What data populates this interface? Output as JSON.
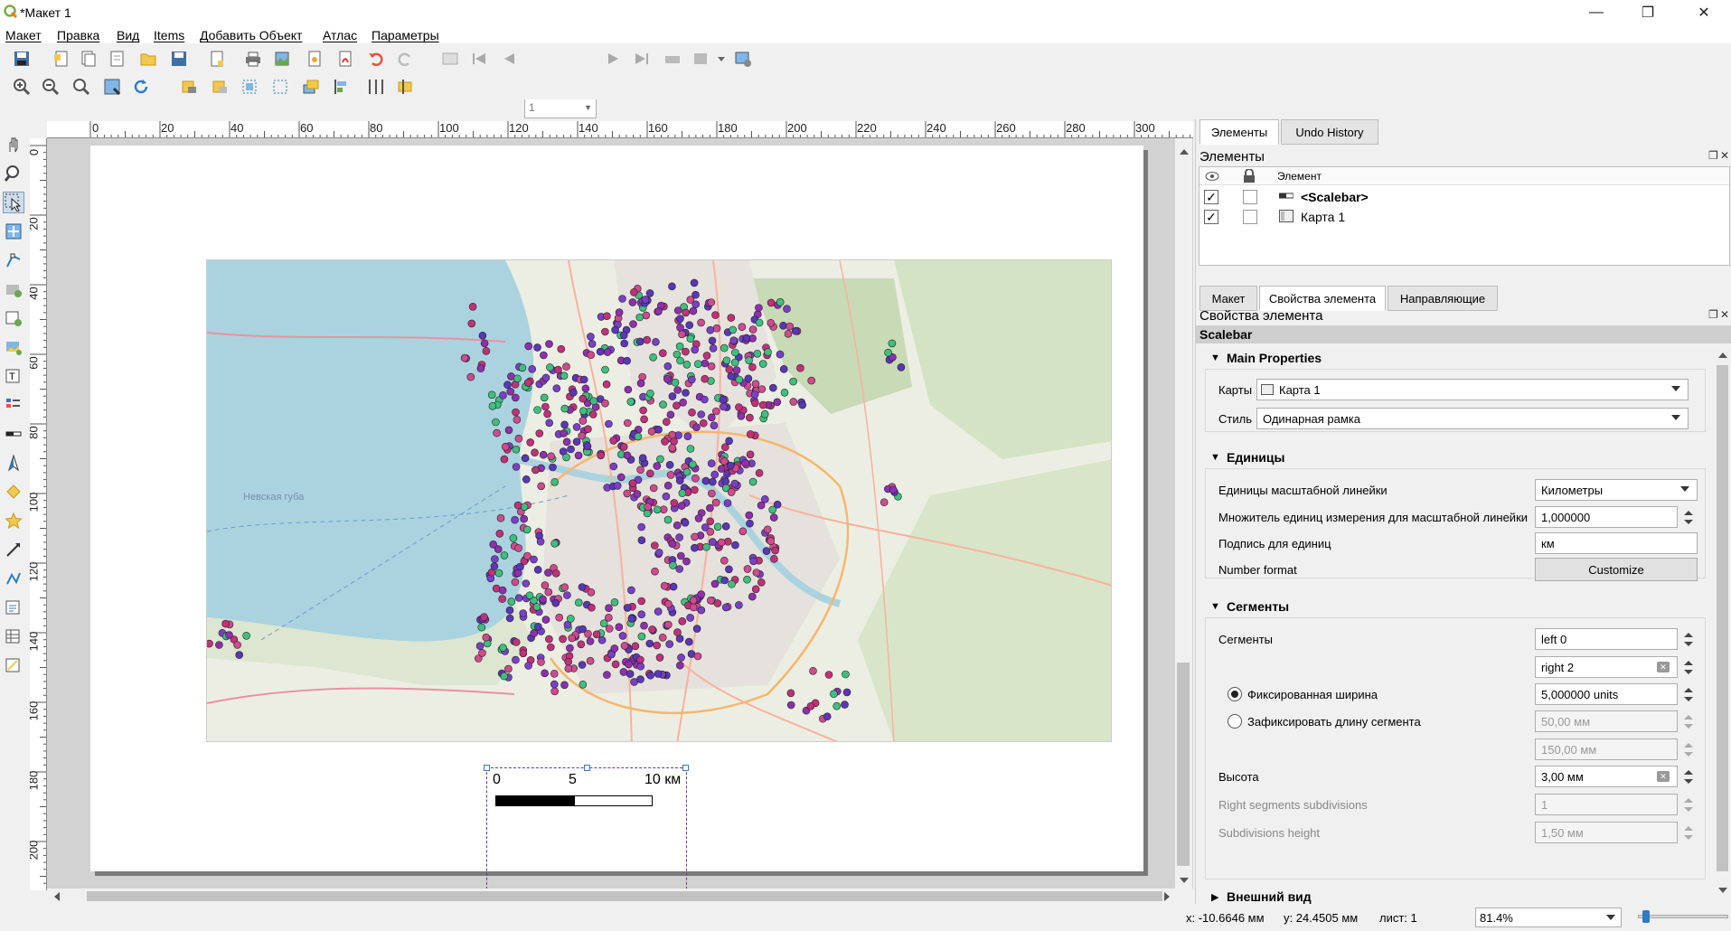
{
  "window": {
    "title": "*Макет 1"
  },
  "menu": [
    "Макет",
    "Правка",
    "Вид",
    "Items",
    "Добавить Объект",
    "Атлас",
    "Параметры"
  ],
  "toolbar": {
    "page_value": "1"
  },
  "ruler": {
    "top_labels": [
      "0",
      "20",
      "40",
      "60",
      "80",
      "100",
      "120",
      "140",
      "160",
      "180",
      "200",
      "220",
      "240",
      "260",
      "280",
      "300"
    ],
    "left_labels": [
      "0",
      "20",
      "40",
      "60",
      "80",
      "100",
      "120",
      "140",
      "160",
      "180",
      "200"
    ]
  },
  "map": {
    "label_bay": "Невская губа"
  },
  "scalebar": {
    "labels": [
      "0",
      "5",
      "10 км"
    ]
  },
  "panel": {
    "top_tabs": [
      "Элементы",
      "Undo History"
    ],
    "items_title": "Элементы",
    "items_header": "Элемент",
    "items": [
      {
        "name": "<Scalebar>",
        "visible": true,
        "locked": false
      },
      {
        "name": "Карта 1",
        "visible": true,
        "locked": false
      }
    ],
    "bottom_tabs": [
      "Макет",
      "Свойства элемента",
      "Направляющие"
    ],
    "props_title": "Свойства элемента",
    "item_type": "Scalebar",
    "main_properties": {
      "header": "Main Properties",
      "map_label": "Карты",
      "map_value": "Карта 1",
      "style_label": "Стиль",
      "style_value": "Одинарная рамка"
    },
    "units": {
      "header": "Единицы",
      "units_label": "Единицы масштабной линейки",
      "units_value": "Километры",
      "multiplier_label": "Множитель единиц измерения для масштабной линейки",
      "multiplier_value": "1,000000",
      "label_label": "Подпись для единиц",
      "label_value": "км",
      "number_format_label": "Number format",
      "customize_button": "Customize"
    },
    "segments": {
      "header": "Сегменты",
      "segments_label": "Сегменты",
      "left_value": "left 0",
      "right_value": "right 2",
      "fixed_width_label": "Фиксированная ширина",
      "fixed_width_value": "5,000000 units",
      "fixed_length_label": "Зафиксировать длину сегмента",
      "fixed_length_value": "50,00 мм",
      "max_length_value": "150,00 мм",
      "height_label": "Высота",
      "height_value": "3,00 мм",
      "right_subdiv_label": "Right segments subdivisions",
      "right_subdiv_value": "1",
      "subdiv_height_label": "Subdivisions height",
      "subdiv_height_value": "1,50 мм"
    },
    "appearance": {
      "header": "Внешний вид"
    }
  },
  "status": {
    "x": "x: -10.6646 мм",
    "y": "y: 24.4505 мм",
    "page": "лист: 1",
    "zoom": "81.4%"
  }
}
